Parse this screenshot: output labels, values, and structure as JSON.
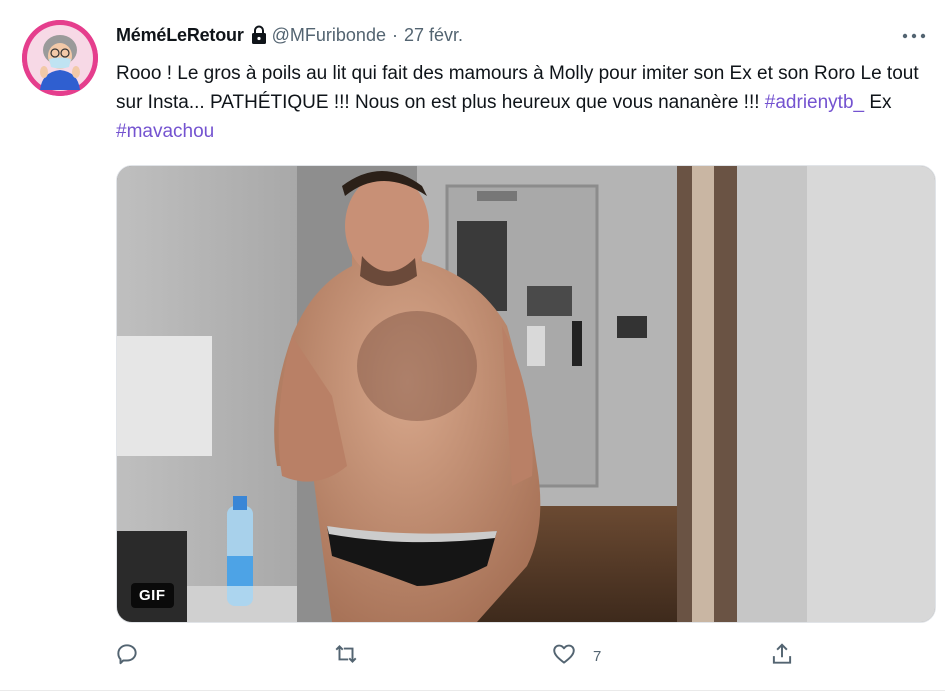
{
  "tweet": {
    "display_name": "MéméLeRetour",
    "handle": "@MFuribonde",
    "separator": "·",
    "date": "27 févr.",
    "text_parts": {
      "p1": "Rooo ! Le gros à poils au lit qui fait des mamours à Molly pour imiter son Ex et son Roro Le tout sur Insta... PATHÉTIQUE !!! Nous on est plus heureux que vous nananère !!! ",
      "hashtag1": "#adrienytb_",
      "p2": " Ex ",
      "hashtag2": "#mavachou"
    },
    "media": {
      "badge": "GIF"
    },
    "actions": {
      "reply_count": "",
      "retweet_count": "",
      "like_count": "7",
      "share_count": ""
    },
    "colors": {
      "hashtag": "#7453d0",
      "secondary_text": "#536471",
      "avatar_ring": "#e53e8d"
    },
    "icons": {
      "lock": "lock-icon",
      "more": "more-dots-icon",
      "reply": "reply-icon",
      "retweet": "retweet-icon",
      "like": "heart-icon",
      "share": "share-icon"
    }
  }
}
